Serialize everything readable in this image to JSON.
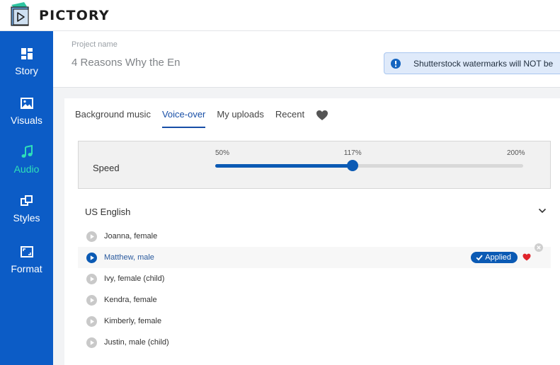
{
  "app": {
    "logo_text": "PICTORY"
  },
  "sidebar": {
    "items": [
      {
        "label": "Story",
        "icon": "story-grid-icon",
        "active": false
      },
      {
        "label": "Visuals",
        "icon": "image-icon",
        "active": false
      },
      {
        "label": "Audio",
        "icon": "music-note-icon",
        "active": true
      },
      {
        "label": "Styles",
        "icon": "styles-icon",
        "active": false
      },
      {
        "label": "Format",
        "icon": "format-icon",
        "active": false
      }
    ]
  },
  "project": {
    "label": "Project name",
    "name": "4 Reasons Why the En"
  },
  "notice": {
    "text": "Shutterstock watermarks will NOT be"
  },
  "tabs": [
    {
      "label": "Background music",
      "active": false
    },
    {
      "label": "Voice-over",
      "active": true
    },
    {
      "label": "My uploads",
      "active": false
    },
    {
      "label": "Recent",
      "active": false
    }
  ],
  "speed": {
    "label": "Speed",
    "min_label": "50%",
    "max_label": "200%",
    "value_label": "117%",
    "min": 50,
    "max": 200,
    "value": 117
  },
  "language": {
    "label": "US English"
  },
  "voices": [
    {
      "name": "Joanna, female",
      "selected": false
    },
    {
      "name": "Matthew, male",
      "selected": true
    },
    {
      "name": "Ivy, female (child)",
      "selected": false
    },
    {
      "name": "Kendra, female",
      "selected": false
    },
    {
      "name": "Kimberly, female",
      "selected": false
    },
    {
      "name": "Justin, male (child)",
      "selected": false
    }
  ],
  "applied_label": "Applied",
  "colors": {
    "sidebar": "#0c5cc6",
    "accent": "#0b5ab4",
    "audio_active": "#2ee0b8",
    "heart": "#e0242b"
  }
}
